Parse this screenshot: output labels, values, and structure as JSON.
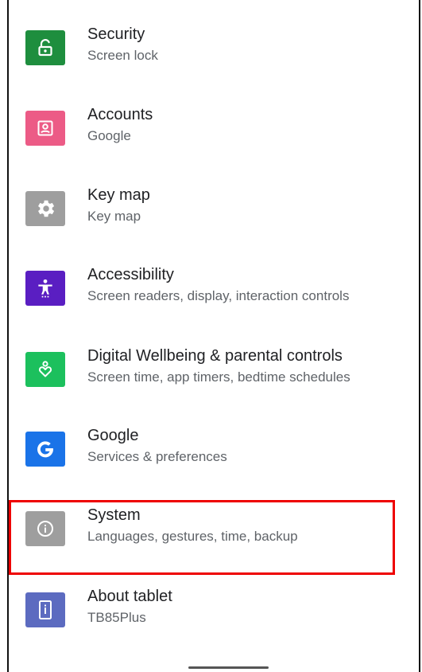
{
  "settings": {
    "items": [
      {
        "title": "Security",
        "subtitle": "Screen lock",
        "icon": "lock-open-icon",
        "color": "#1e8e3e"
      },
      {
        "title": "Accounts",
        "subtitle": "Google",
        "icon": "account-box-icon",
        "color": "#ec5b86"
      },
      {
        "title": "Key map",
        "subtitle": "Key map",
        "icon": "gear-icon",
        "color": "#9e9e9e"
      },
      {
        "title": "Accessibility",
        "subtitle": "Screen readers, display, interaction controls",
        "icon": "accessibility-icon",
        "color": "#5a1ec2"
      },
      {
        "title": "Digital Wellbeing & parental controls",
        "subtitle": "Screen time, app timers, bedtime schedules",
        "icon": "wellbeing-heart-icon",
        "color": "#1cc05d"
      },
      {
        "title": "Google",
        "subtitle": "Services & preferences",
        "icon": "google-g-icon",
        "color": "#1a73e8"
      },
      {
        "title": "System",
        "subtitle": "Languages, gestures, time, backup",
        "icon": "info-icon",
        "color": "#9e9e9e"
      },
      {
        "title": "About tablet",
        "subtitle": "TB85Plus",
        "icon": "tablet-info-icon",
        "color": "#5c6bc0"
      }
    ]
  },
  "highlight": {
    "target": "System",
    "color": "#ee0000"
  }
}
